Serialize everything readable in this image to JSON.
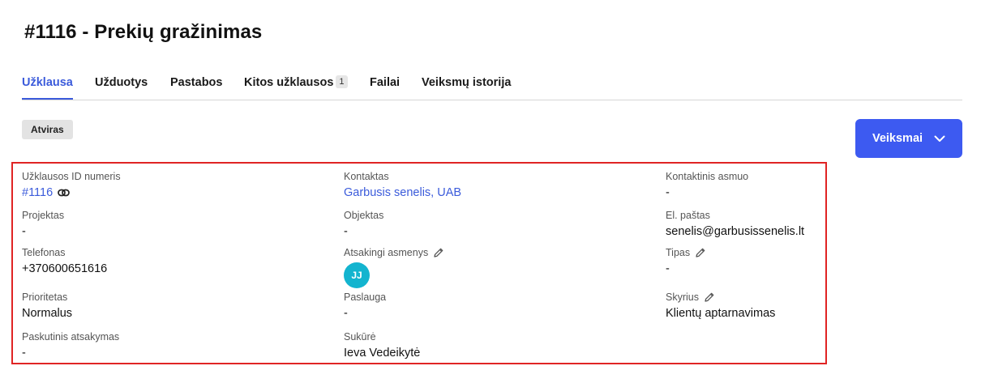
{
  "page": {
    "title": "#1116 - Prekių gražinimas"
  },
  "tabs": [
    {
      "label": "Užklausa",
      "active": true
    },
    {
      "label": "Užduotys"
    },
    {
      "label": "Pastabos"
    },
    {
      "label": "Kitos užklausos",
      "badge": "1"
    },
    {
      "label": "Failai"
    },
    {
      "label": "Veiksmų istorija"
    }
  ],
  "status": "Atviras",
  "actions": {
    "label": "Veiksmai",
    "icon": "chevron-down-icon"
  },
  "fields": {
    "request_id": {
      "label": "Užklausos ID numeris",
      "value": "#1116",
      "icon": "link-icon"
    },
    "project": {
      "label": "Projektas",
      "value": "-"
    },
    "phone": {
      "label": "Telefonas",
      "value": "+370600651616"
    },
    "priority": {
      "label": "Prioritetas",
      "value": "Normalus"
    },
    "last_reply": {
      "label": "Paskutinis atsakymas",
      "value": "-"
    },
    "contact": {
      "label": "Kontaktas",
      "value": "Garbusis senelis, UAB"
    },
    "object": {
      "label": "Objektas",
      "value": "-"
    },
    "responsible": {
      "label": "Atsakingi asmenys",
      "avatar_initials": "JJ",
      "icon": "pencil-icon"
    },
    "service": {
      "label": "Paslauga",
      "value": "-"
    },
    "created_by": {
      "label": "Sukūrė",
      "value": "Ieva Vedeikytė"
    },
    "contact_person": {
      "label": "Kontaktinis asmuo",
      "value": "-"
    },
    "email": {
      "label": "El. paštas",
      "value": "senelis@garbusissenelis.lt"
    },
    "type": {
      "label": "Tipas",
      "value": "-",
      "icon": "pencil-icon"
    },
    "department": {
      "label": "Skyrius",
      "value": "Klientų aptarnavimas",
      "icon": "pencil-icon"
    }
  },
  "colors": {
    "accent": "#3d5af1",
    "link": "#3b5bdb",
    "highlight_border": "#e02424",
    "avatar": "#13b4cf"
  }
}
